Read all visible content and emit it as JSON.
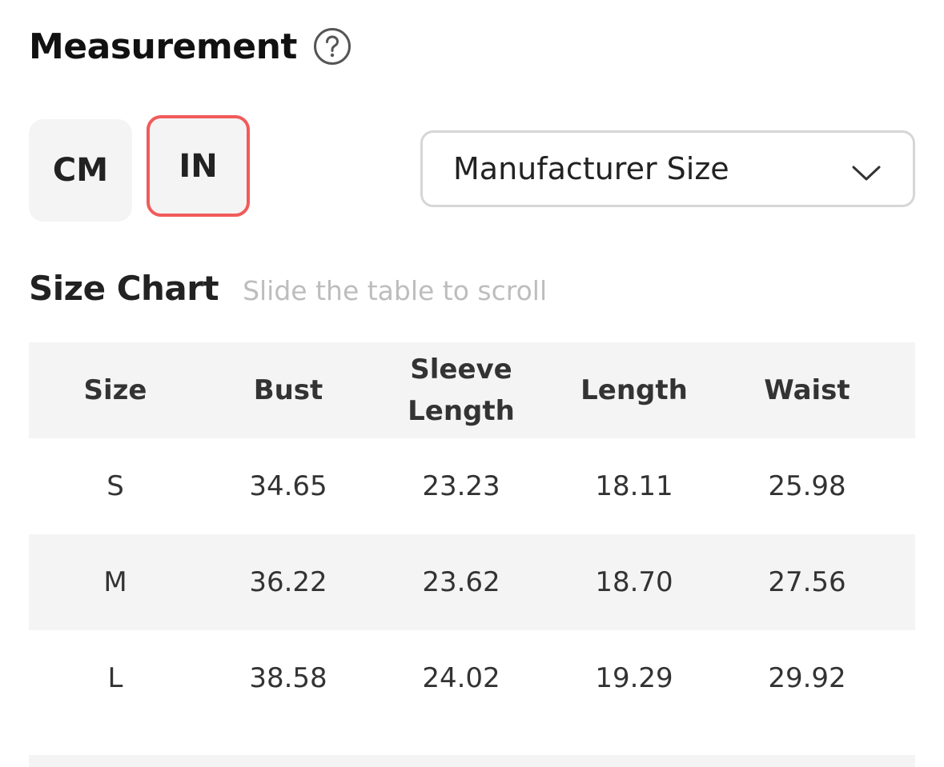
{
  "measurement": {
    "title": "Measurement",
    "help_icon": "question-circle-icon"
  },
  "units": {
    "cm_label": "CM",
    "in_label": "IN",
    "selected": "IN",
    "selected_border_color": "#f25a5a"
  },
  "size_select": {
    "value": "Manufacturer Size",
    "icon": "chevron-down-icon"
  },
  "size_chart": {
    "title": "Size Chart",
    "hint": "Slide the table to scroll"
  },
  "table": {
    "headers": [
      "Size",
      "Bust",
      "Sleeve Length",
      "Length",
      "Waist"
    ],
    "rows": [
      [
        "S",
        "34.65",
        "23.23",
        "18.11",
        "25.98"
      ],
      [
        "M",
        "36.22",
        "23.62",
        "18.70",
        "27.56"
      ],
      [
        "L",
        "38.58",
        "24.02",
        "19.29",
        "29.92"
      ]
    ]
  }
}
